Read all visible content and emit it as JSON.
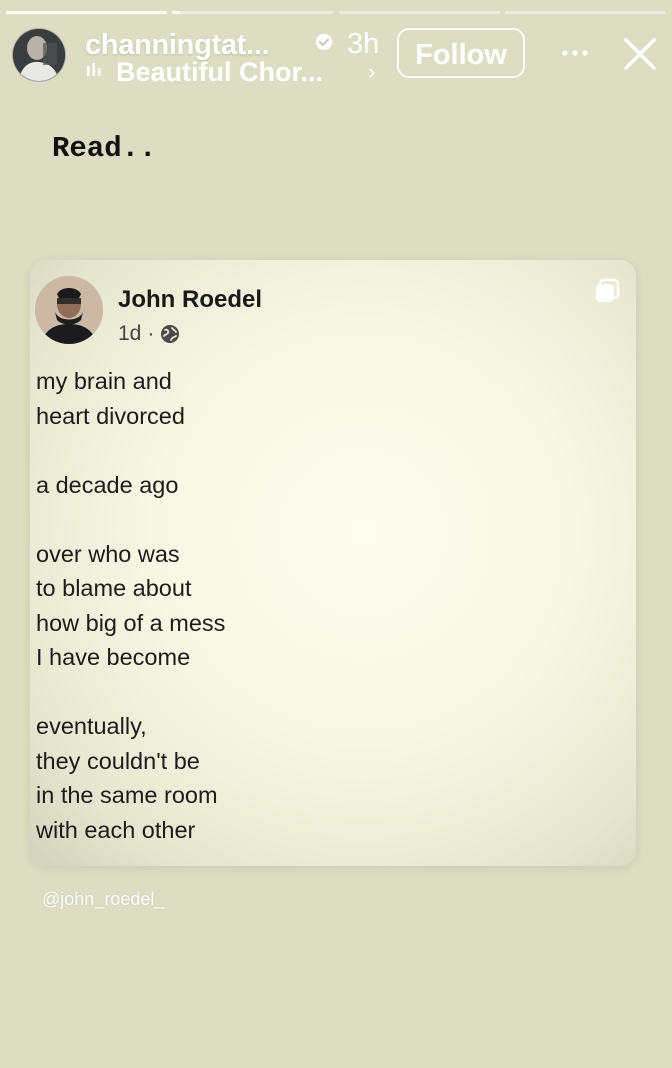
{
  "story": {
    "progress": {
      "segments": 4,
      "active_segment": 1,
      "active_fraction": 0.6
    },
    "header": {
      "username": "channingtat...",
      "verified_icon": "verified-badge-icon",
      "time_ago": "3h",
      "music_title": "Beautiful Chor...",
      "music_chevron": "›",
      "follow_label": "Follow",
      "more_icon": "more-options-icon",
      "close_icon": "close-icon"
    },
    "caption": "Read..",
    "post": {
      "author": "John Roedel",
      "age": "1d",
      "separator": "·",
      "privacy_icon": "globe-icon",
      "copy_icon": "multiple-images-icon",
      "body_lines": [
        "my brain and",
        "heart divorced",
        "",
        "a decade ago",
        "",
        "over who was",
        "to blame about",
        "how big of a mess",
        "I have become",
        "",
        "eventually,",
        "they couldn't be",
        "in the same room",
        "with each other"
      ]
    },
    "mention": "@john_roedel_"
  },
  "colors": {
    "background": "#dcddc3",
    "card": "#f7f7e4",
    "text_dark": "#1c1c1c",
    "overlay_text": "#ffffff"
  }
}
